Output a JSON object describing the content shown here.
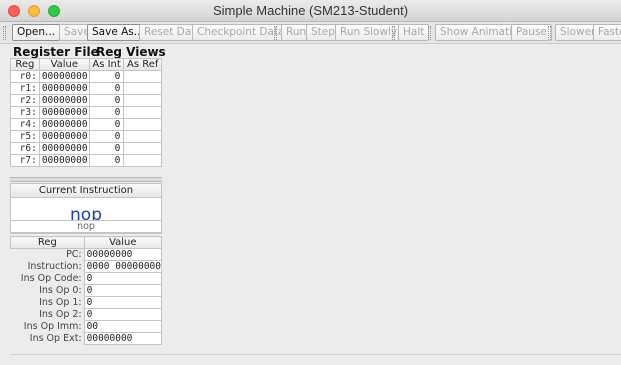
{
  "window": {
    "title": "Simple Machine (SM213-Student)"
  },
  "toolbar": {
    "buttons": [
      {
        "label": "Open...",
        "enabled": true
      },
      {
        "label": "Save",
        "enabled": false
      },
      {
        "label": "Save As...",
        "enabled": true
      },
      {
        "label": "Reset Data",
        "enabled": false
      },
      {
        "label": "Checkpoint Data",
        "enabled": false
      },
      {
        "label": "Run",
        "enabled": false
      },
      {
        "label": "Step",
        "enabled": false
      },
      {
        "label": "Run Slowly",
        "enabled": false
      },
      {
        "label": "Halt",
        "enabled": false
      },
      {
        "label": "Show Animation",
        "enabled": false
      },
      {
        "label": "Pause",
        "enabled": false
      },
      {
        "label": "Slower",
        "enabled": false
      },
      {
        "label": "Faste",
        "enabled": false
      }
    ]
  },
  "register_file": {
    "title": "Register File",
    "views_title": "Reg Views",
    "columns": [
      "Reg",
      "Value",
      "As Int",
      "As Ref"
    ],
    "rows": [
      {
        "reg": "r0:",
        "value": "00000000",
        "as_int": "0",
        "as_ref": ""
      },
      {
        "reg": "r1:",
        "value": "00000000",
        "as_int": "0",
        "as_ref": ""
      },
      {
        "reg": "r2:",
        "value": "00000000",
        "as_int": "0",
        "as_ref": ""
      },
      {
        "reg": "r3:",
        "value": "00000000",
        "as_int": "0",
        "as_ref": ""
      },
      {
        "reg": "r4:",
        "value": "00000000",
        "as_int": "0",
        "as_ref": ""
      },
      {
        "reg": "r5:",
        "value": "00000000",
        "as_int": "0",
        "as_ref": ""
      },
      {
        "reg": "r6:",
        "value": "00000000",
        "as_int": "0",
        "as_ref": ""
      },
      {
        "reg": "r7:",
        "value": "00000000",
        "as_int": "0",
        "as_ref": ""
      }
    ]
  },
  "current_instruction": {
    "title": "Current Instruction",
    "mnemonic": "nop",
    "text": "nop"
  },
  "internal_regs": {
    "columns": [
      "Reg",
      "Value"
    ],
    "rows": [
      {
        "label": "PC:",
        "value": "00000000"
      },
      {
        "label": "Instruction:",
        "value": "0000 00000000"
      },
      {
        "label": "Ins Op Code:",
        "value": "0"
      },
      {
        "label": "Ins Op 0:",
        "value": "0"
      },
      {
        "label": "Ins Op 1:",
        "value": "0"
      },
      {
        "label": "Ins Op 2:",
        "value": "0"
      },
      {
        "label": "Ins Op Imm:",
        "value": "00"
      },
      {
        "label": "Ins Op Ext:",
        "value": "00000000"
      }
    ]
  },
  "colors": {
    "accent_text": "#1d3fa3",
    "close": "#fc605c",
    "minimize": "#fdbc40",
    "maximize": "#34c84a"
  }
}
